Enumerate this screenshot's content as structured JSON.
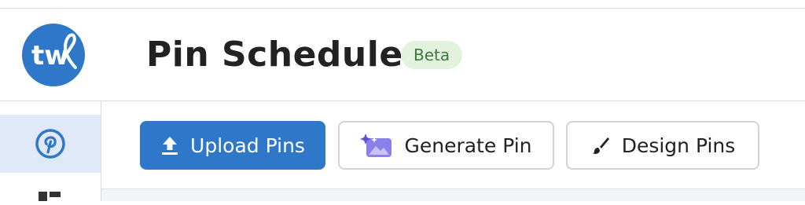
{
  "header": {
    "logo_text": "tw",
    "title": "Pin Scheduler",
    "badge": "Beta"
  },
  "sidebar": {
    "items": [
      {
        "name": "pinterest",
        "icon": "pinterest-icon",
        "active": true
      },
      {
        "name": "dashboard",
        "icon": "grid-icon",
        "active": false
      }
    ]
  },
  "toolbar": {
    "upload_label": "Upload Pins",
    "generate_label": "Generate Pin",
    "design_label": "Design Pins"
  },
  "colors": {
    "brand_blue": "#2f77c9",
    "badge_bg": "#e3f1df",
    "badge_text": "#3c7b3a",
    "sidebar_active_bg": "#dfe9f7",
    "generate_icon_purple": "#7b6fe0"
  }
}
